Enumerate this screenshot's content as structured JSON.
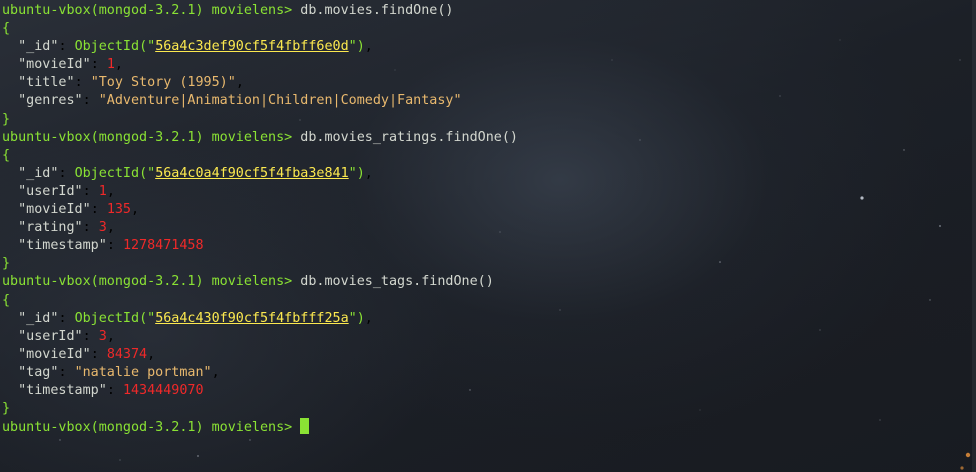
{
  "terminal": {
    "prompt": "ubuntu-vbox(mongod-3.2.1) movielens>",
    "open_brace": "{",
    "close_brace": "}",
    "blocks": [
      {
        "command": "db.movies.findOne()",
        "id": "56a4c3def90cf5f4fbff6e0d",
        "fields": [
          {
            "key": "\"movieId\"",
            "value": "1",
            "kind": "num"
          },
          {
            "key": "\"title\"",
            "value": "\"Toy Story (1995)\"",
            "kind": "str"
          },
          {
            "key": "\"genres\"",
            "value": "\"Adventure|Animation|Children|Comedy|Fantasy\"",
            "kind": "str"
          }
        ]
      },
      {
        "command": "db.movies_ratings.findOne()",
        "id": "56a4c0a4f90cf5f4fba3e841",
        "fields": [
          {
            "key": "\"userId\"",
            "value": "1",
            "kind": "num"
          },
          {
            "key": "\"movieId\"",
            "value": "135",
            "kind": "num"
          },
          {
            "key": "\"rating\"",
            "value": "3",
            "kind": "num"
          },
          {
            "key": "\"timestamp\"",
            "value": "1278471458",
            "kind": "num"
          }
        ]
      },
      {
        "command": "db.movies_tags.findOne()",
        "id": "56a4c430f90cf5f4fbfff25a",
        "fields": [
          {
            "key": "\"userId\"",
            "value": "3",
            "kind": "num"
          },
          {
            "key": "\"movieId\"",
            "value": "84374",
            "kind": "num"
          },
          {
            "key": "\"tag\"",
            "value": "\"natalie portman\"",
            "kind": "str"
          },
          {
            "key": "\"timestamp\"",
            "value": "1434449070",
            "kind": "num"
          }
        ]
      }
    ],
    "id_key": "\"_id\"",
    "objectid_fn": "ObjectId",
    "colors": {
      "prompt": "#8ae234",
      "number": "#ef2929",
      "string": "#e9b96e",
      "objectid_value": "#fce94f",
      "default_text": "#d3d7cf",
      "cursor": "#8ae234"
    },
    "icons": {
      "cursor": "block-cursor"
    }
  }
}
